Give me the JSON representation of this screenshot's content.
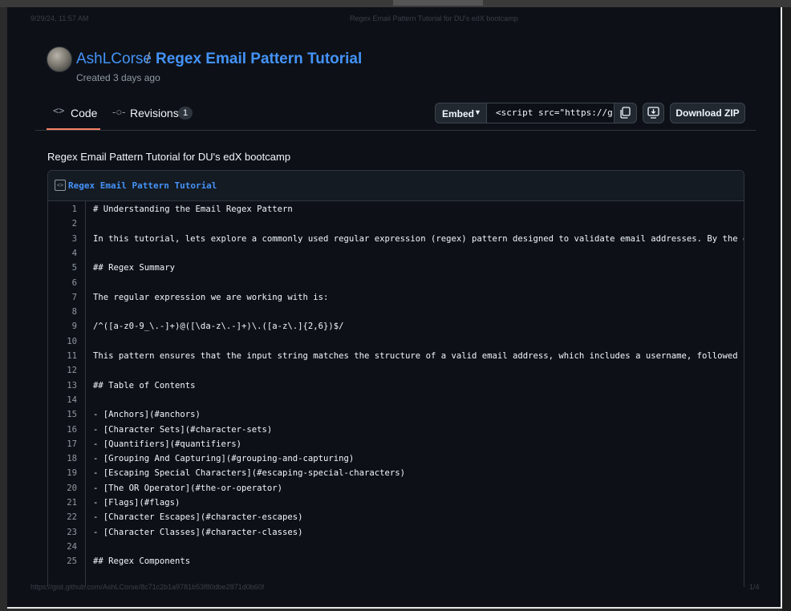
{
  "print_header": {
    "datetime": "9/29/24, 11:57 AM",
    "title": "Regex Email Pattern Tutorial for DU's edX bootcamp"
  },
  "print_footer": {
    "url": "https://gist.github.com/AshLCorse/8c71c2b1a9781b53f80dbe2871d0b60f",
    "page": "1/4"
  },
  "gist": {
    "owner": "AshLCorse",
    "separator": "/",
    "name": "Regex Email Pattern Tutorial",
    "created": "Created 3 days ago"
  },
  "tabs": {
    "code_icon": "<>",
    "code_label": "Code",
    "revisions_label": "Revisions",
    "revisions_count": "1"
  },
  "actions": {
    "embed_label": "Embed",
    "embed_value": "<script src=\"https://g",
    "download_label": "Download ZIP"
  },
  "description": "Regex Email Pattern Tutorial for DU's edX bootcamp",
  "file": {
    "name": "Regex Email Pattern Tutorial",
    "lines": [
      {
        "n": "1",
        "text": "# Understanding the Email Regex Pattern"
      },
      {
        "n": "2",
        "text": ""
      },
      {
        "n": "3",
        "text": "In this tutorial, lets explore a commonly used regular expression (regex) pattern designed to validate email addresses. By the end of t"
      },
      {
        "n": "4",
        "text": ""
      },
      {
        "n": "5",
        "text": "## Regex Summary"
      },
      {
        "n": "6",
        "text": ""
      },
      {
        "n": "7",
        "text": "The regular expression we are working with is:"
      },
      {
        "n": "8",
        "text": ""
      },
      {
        "n": "9",
        "text": "/^([a-z0-9_\\.-]+)@([\\da-z\\.-]+)\\.([a-z\\.]{2,6})$/"
      },
      {
        "n": "10",
        "text": ""
      },
      {
        "n": "11",
        "text": "This pattern ensures that the input string matches the structure of a valid email address, which includes a username, followed by the '"
      },
      {
        "n": "12",
        "text": ""
      },
      {
        "n": "13",
        "text": "## Table of Contents"
      },
      {
        "n": "14",
        "text": ""
      },
      {
        "n": "15",
        "text": "- [Anchors](#anchors)"
      },
      {
        "n": "16",
        "text": "- [Character Sets](#character-sets)"
      },
      {
        "n": "17",
        "text": "- [Quantifiers](#quantifiers)"
      },
      {
        "n": "18",
        "text": "- [Grouping And Capturing](#grouping-and-capturing)"
      },
      {
        "n": "19",
        "text": "- [Escaping Special Characters](#escaping-special-characters)"
      },
      {
        "n": "20",
        "text": "- [The OR Operator](#the-or-operator)"
      },
      {
        "n": "21",
        "text": "- [Flags](#flags)"
      },
      {
        "n": "22",
        "text": "- [Character Escapes](#character-escapes)"
      },
      {
        "n": "23",
        "text": "- [Character Classes](#character-classes)"
      },
      {
        "n": "24",
        "text": ""
      },
      {
        "n": "25",
        "text": "## Regex Components"
      }
    ]
  }
}
